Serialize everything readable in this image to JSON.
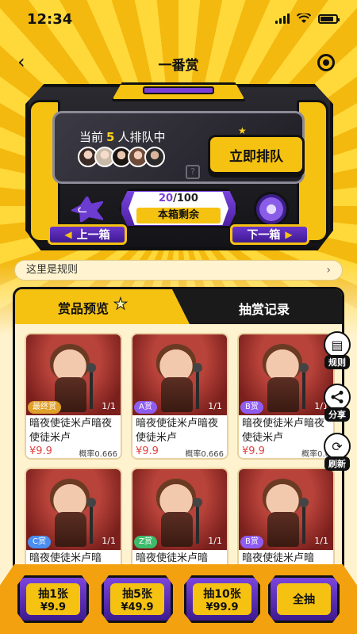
{
  "status": {
    "time": "12:34"
  },
  "nav": {
    "title": "一番赏",
    "back_icon": "chevron-left-icon",
    "capsule_icon": "target-icon"
  },
  "queue": {
    "prefix": "当前",
    "count": "5",
    "suffix": "人排队中",
    "button": "立即排队",
    "remaining_current": "20",
    "remaining_total": "/100",
    "remaining_label": "本箱剩余",
    "prev": "上一箱",
    "next": "下一箱"
  },
  "rules": {
    "text": "这里是规则"
  },
  "tabs": {
    "active": "赏品预览",
    "other": "抽赏记录"
  },
  "side": {
    "rules": "规则",
    "share": "分享",
    "refresh": "刷新"
  },
  "prizes": [
    {
      "badge": "最终赏",
      "stock": "1/1",
      "title": "暗夜使徒米卢暗夜使徒米卢",
      "price": "¥9.9",
      "prob": "概率0.666"
    },
    {
      "badge": "A赏",
      "stock": "1/1",
      "title": "暗夜使徒米卢暗夜使徒米卢",
      "price": "¥9.9",
      "prob": "概率0.666"
    },
    {
      "badge": "B赏",
      "stock": "1/1",
      "title": "暗夜使徒米卢暗夜使徒米卢",
      "price": "¥9.9",
      "prob": "概率0.6"
    },
    {
      "badge": "C赏",
      "stock": "1/1",
      "title": "暗夜使徒米卢暗",
      "price": "",
      "prob": ""
    },
    {
      "badge": "Z赏",
      "stock": "1/1",
      "title": "暗夜使徒米卢暗",
      "price": "",
      "prob": ""
    },
    {
      "badge": "B赏",
      "stock": "1/1",
      "title": "暗夜使徒米卢暗",
      "price": "",
      "prob": ""
    }
  ],
  "draw": [
    {
      "label": "抽1张",
      "amount": "¥9.9"
    },
    {
      "label": "抽5张",
      "amount": "¥49.9"
    },
    {
      "label": "抽10张",
      "amount": "¥99.9"
    },
    {
      "label": "全抽",
      "amount": ""
    }
  ]
}
